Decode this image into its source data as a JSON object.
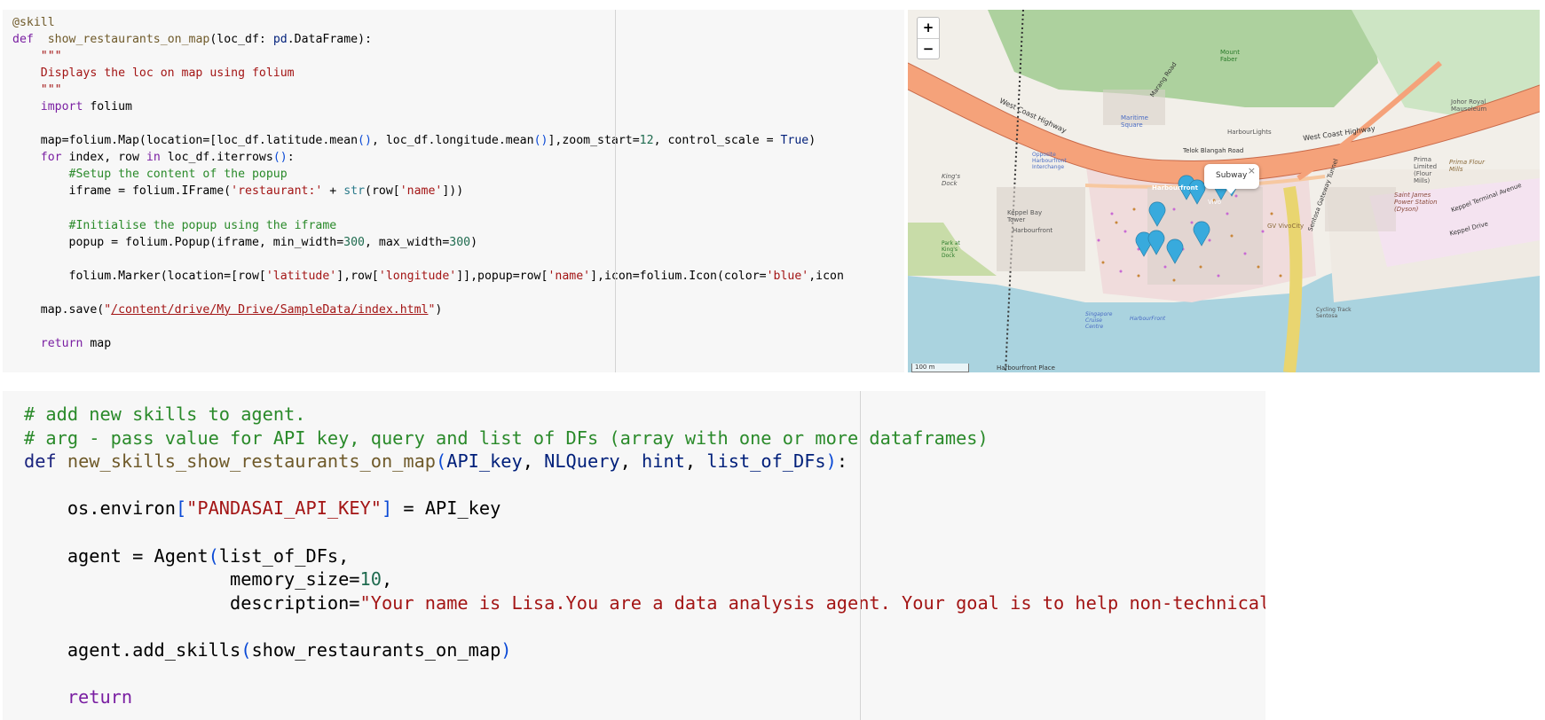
{
  "cell1": {
    "lines": [
      [
        [
          "t-dec",
          "@skill"
        ]
      ],
      [
        [
          "t-kw",
          "def"
        ],
        [
          "",
          "  "
        ],
        [
          "t-fn",
          "show_restaurants_on_map"
        ],
        [
          "",
          "(loc_df: "
        ],
        [
          "t-var",
          "pd"
        ],
        [
          "",
          ".DataFrame):"
        ]
      ],
      [
        [
          "",
          "    "
        ],
        [
          "t-str",
          "\"\"\""
        ]
      ],
      [
        [
          "",
          "    "
        ],
        [
          "t-str",
          "Displays the loc on map using folium"
        ]
      ],
      [
        [
          "",
          "    "
        ],
        [
          "t-str",
          "\"\"\""
        ]
      ],
      [
        [
          "",
          "    "
        ],
        [
          "t-kw",
          "import"
        ],
        [
          "",
          " folium"
        ]
      ],
      [
        [
          "",
          ""
        ]
      ],
      [
        [
          "",
          "    map=folium.Map(location=["
        ],
        [
          "",
          "loc_df.latitude.mean"
        ],
        [
          "t-par",
          "()"
        ],
        [
          "",
          ", loc_df.longitude.mean"
        ],
        [
          "t-par",
          "()"
        ],
        [
          "",
          "],zoom_start="
        ],
        [
          "t-num",
          "12"
        ],
        [
          "",
          ", control_scale = "
        ],
        [
          "t-var",
          "True"
        ],
        [
          "",
          ")"
        ]
      ],
      [
        [
          "",
          "    "
        ],
        [
          "t-kw",
          "for"
        ],
        [
          "",
          " index, row "
        ],
        [
          "t-kw",
          "in"
        ],
        [
          "",
          " loc_df.iterrows"
        ],
        [
          "t-par",
          "()"
        ],
        [
          "",
          ":"
        ]
      ],
      [
        [
          "",
          "        "
        ],
        [
          "t-cm",
          "#Setup the content of the popup"
        ]
      ],
      [
        [
          "",
          "        iframe = folium.IFrame("
        ],
        [
          "t-str",
          "'restaurant:'"
        ],
        [
          "",
          " + "
        ],
        [
          "t-bi",
          "str"
        ],
        [
          "",
          "(row["
        ],
        [
          "t-str",
          "'name'"
        ],
        [
          "",
          "]))"
        ]
      ],
      [
        [
          "",
          ""
        ]
      ],
      [
        [
          "",
          "        "
        ],
        [
          "t-cm",
          "#Initialise the popup using the iframe"
        ]
      ],
      [
        [
          "",
          "        popup = folium.Popup(iframe, min_width="
        ],
        [
          "t-num",
          "300"
        ],
        [
          "",
          ", max_width="
        ],
        [
          "t-num",
          "300"
        ],
        [
          "",
          ")"
        ]
      ],
      [
        [
          "",
          ""
        ]
      ],
      [
        [
          "",
          "        folium.Marker(location=[row["
        ],
        [
          "t-str",
          "'latitude'"
        ],
        [
          "",
          "],row["
        ],
        [
          "t-str",
          "'longitude'"
        ],
        [
          "",
          "]],popup=row["
        ],
        [
          "t-str",
          "'name'"
        ],
        [
          "",
          "],icon=folium.Icon(color="
        ],
        [
          "t-str",
          "'blue'"
        ],
        [
          "",
          ",icon"
        ]
      ],
      [
        [
          "",
          ""
        ]
      ],
      [
        [
          "",
          "    map.save("
        ],
        [
          "t-str",
          "\""
        ],
        [
          "t-str u",
          "/content/drive/My Drive/SampleData/index.html"
        ],
        [
          "t-str",
          "\""
        ],
        [
          "",
          ")"
        ]
      ],
      [
        [
          "",
          ""
        ]
      ],
      [
        [
          "",
          "    "
        ],
        [
          "t-kw",
          "return"
        ],
        [
          "",
          " map"
        ]
      ]
    ]
  },
  "cell2": {
    "lines": [
      [
        [
          "t-cm",
          "# add new skills to agent."
        ]
      ],
      [
        [
          "t-cm",
          "# arg - pass value for API key, query and list of DFs (array with one or more dataframes)"
        ]
      ],
      [
        [
          "t-def",
          "def"
        ],
        [
          "",
          " "
        ],
        [
          "t-fn",
          "new_skills_show_restaurants_on_map"
        ],
        [
          "t-par",
          "("
        ],
        [
          "t-var",
          "API_key"
        ],
        [
          "",
          ", "
        ],
        [
          "t-var",
          "NLQuery"
        ],
        [
          "",
          ", "
        ],
        [
          "t-var",
          "hint"
        ],
        [
          "",
          ", "
        ],
        [
          "t-var",
          "list_of_DFs"
        ],
        [
          "t-par",
          ")"
        ],
        [
          "",
          ":"
        ]
      ],
      [
        [
          "",
          ""
        ]
      ],
      [
        [
          "",
          "    os.environ"
        ],
        [
          "t-par",
          "["
        ],
        [
          "t-str",
          "\"PANDASAI_API_KEY\""
        ],
        [
          "t-par",
          "]"
        ],
        [
          "",
          " = API_key"
        ]
      ],
      [
        [
          "",
          ""
        ]
      ],
      [
        [
          "",
          "    agent = Agent"
        ],
        [
          "t-par",
          "("
        ],
        [
          "",
          "list_of_DFs,"
        ]
      ],
      [
        [
          "",
          "                   memory_size="
        ],
        [
          "t-num",
          "10"
        ],
        [
          "",
          ","
        ]
      ],
      [
        [
          "",
          "                   description="
        ],
        [
          "t-str",
          "\"Your name is Lisa.You are a data analysis agent. Your goal is to help non-technical us"
        ]
      ],
      [
        [
          "",
          ""
        ]
      ],
      [
        [
          "",
          "    agent.add_skills"
        ],
        [
          "t-par",
          "("
        ],
        [
          "",
          "show_restaurants_on_map"
        ],
        [
          "t-par",
          ")"
        ]
      ],
      [
        [
          "",
          ""
        ]
      ],
      [
        [
          "",
          "    "
        ],
        [
          "t-kw",
          "return"
        ]
      ]
    ]
  },
  "map": {
    "zoom_in": "+",
    "zoom_out": "−",
    "popup_label": "Subway",
    "popup_close": "×",
    "labels": {
      "west_coast_hwy_1": "West Coast Highway",
      "west_coast_hwy_2": "West Coast Highway",
      "telok_blangah": "Telok Blangah Road",
      "maritime_square": "Maritime Square",
      "harbourlights": "HarbourLights",
      "keppel_bay_tower": "Keppel Bay Tower",
      "harbourfront": "Harbourfront",
      "harbourfront_place": "Harbourfront Place",
      "johor_royal": "Johor Royal Mausoleum",
      "prima_limited": "Prima Limited (Flour Mills)",
      "prima_flour": "Prima Flour Mills",
      "saint_james": "Saint James Power Station (Dyson)",
      "keppel_terminal": "Keppel Terminal Avenue",
      "keppel_drive": "Keppel Drive",
      "gv_vivocity": "GV VivoCity",
      "sentosa_gateway": "Sentosa Gateway Tunnel",
      "mount_faber": "Mount Faber",
      "keppel_dock": "King's Dock",
      "park_kings_dock": "Park at King's Dock",
      "harbourfront_label": "Harbourfront",
      "cycling_track": "Cycling Track Sentosa",
      "marang_road": "Marang Road",
      "opposite_interchange": "Opposite Harbourfront Interchange",
      "singapore_cruise": "Singapore Cruise Centre",
      "harbour_front_2": "HarbourFront",
      "vivo": "Vivo"
    },
    "scale_text": "100 m",
    "colors": {
      "water": "#aad3df",
      "land": "#f2efe9",
      "green": "#add19e",
      "highway": "#f5a27a",
      "marker": "#38aadd"
    }
  }
}
